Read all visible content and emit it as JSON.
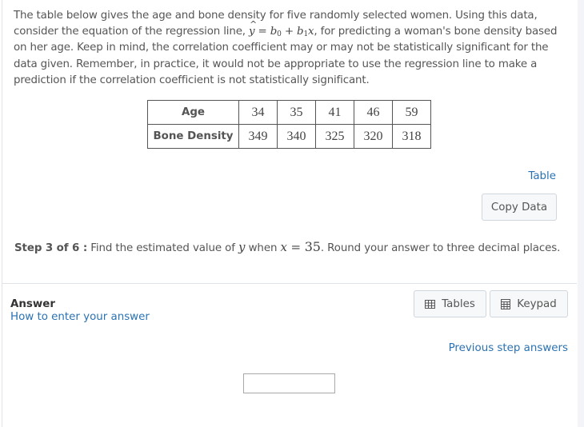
{
  "intro": {
    "part1": "The table below gives the age and bone density for five randomly selected women. Using this data, consider the equation of the regression line, ",
    "eq_yhat": "y",
    "eq_equals": " = ",
    "eq_b0": "b",
    "eq_b0_sub": "0",
    "eq_plus": " + ",
    "eq_b1": "b",
    "eq_b1_sub": "1",
    "eq_x": "x",
    "part2": ", for predicting a woman's bone density based on her age. Keep in mind, the correlation coefficient may or may not be statistically significant for the data given. Remember, in practice, it would not be appropriate to use the regression line to make a prediction if the correlation coefficient is not statistically significant."
  },
  "table": {
    "rows": [
      {
        "header": "Age",
        "values": [
          "34",
          "35",
          "41",
          "46",
          "59"
        ]
      },
      {
        "header": "Bone Density",
        "values": [
          "349",
          "340",
          "325",
          "320",
          "318"
        ]
      }
    ]
  },
  "links": {
    "table": "Table",
    "how_to_enter": "How to enter your answer",
    "previous_step_answers": "Previous step answers"
  },
  "buttons": {
    "copy_data": "Copy Data",
    "tables": "Tables",
    "keypad": "Keypad"
  },
  "step": {
    "label": "Step 3 of 6 :",
    "text1": " Find the estimated value of ",
    "var_y": "y",
    "text2": " when ",
    "var_x": "x",
    "equals": " = ",
    "value": "35",
    "text3": ". Round your answer to three decimal places."
  },
  "answer": {
    "label": "Answer",
    "value": ""
  },
  "colors": {
    "link": "#2a72b3",
    "text": "#555555"
  }
}
